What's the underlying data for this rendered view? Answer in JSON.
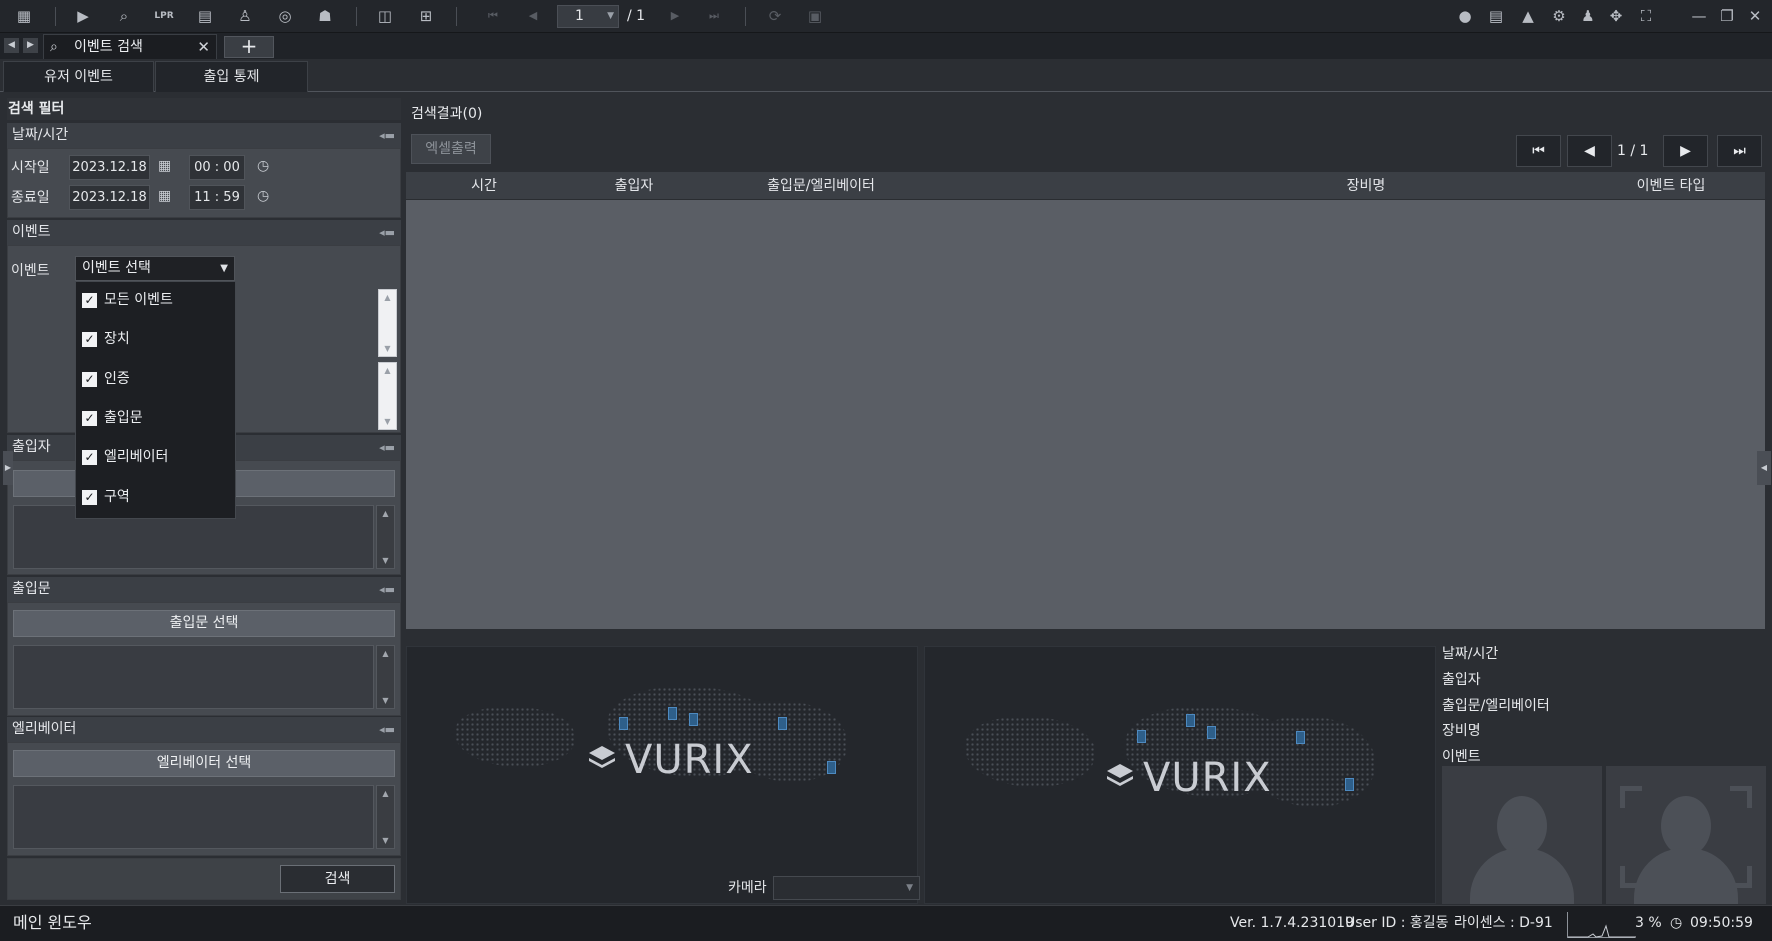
{
  "toolbar": {
    "icons": [
      "grid-icon",
      "play-icon",
      "playback-search-icon",
      "lpr-icon",
      "layout-icon",
      "person-search-icon",
      "bicycle-icon",
      "user-map-icon",
      "split-view-icon",
      "add-screen-icon",
      "first-page-icon",
      "prev-page-icon",
      "next-page-icon",
      "last-page-icon",
      "refresh-icon",
      "calendar-refresh-icon",
      "chat-icon",
      "notice-icon",
      "alarm-icon",
      "settings-icon",
      "user-icon",
      "move-icon",
      "fullscreen-icon",
      "minimize-icon",
      "restore-icon",
      "close-icon"
    ],
    "lpr_label": "LPR",
    "page_current": "1",
    "page_total": "/ 1"
  },
  "tabs": {
    "main_tab_label": "이벤트 검색",
    "add_label": "+"
  },
  "subtabs": [
    "유저 이벤트",
    "출입 통제"
  ],
  "filter": {
    "title": "검색 필터",
    "datetime": {
      "header": "날짜/시간",
      "start_label": "시작일",
      "start_date": "2023.12.18",
      "start_time": "00 : 00",
      "end_label": "종료일",
      "end_date": "2023.12.18",
      "end_time": "11 : 59"
    },
    "event": {
      "header": "이벤트",
      "label": "이벤트",
      "select_value": "이벤트 선택",
      "options": [
        "모든 이벤트",
        "장치",
        "인증",
        "출입문",
        "엘리베이터",
        "구역"
      ]
    },
    "person": {
      "header": "출입자"
    },
    "door": {
      "header": "출입문",
      "button": "출입문 선택"
    },
    "elevator": {
      "header": "엘리베이터",
      "button": "엘리베이터 선택"
    },
    "search_button": "검색"
  },
  "results": {
    "title": "검색결과(0)",
    "excel_button": "엑셀출력",
    "page_text": "1  /  1",
    "columns": [
      "시간",
      "출입자",
      "출입문/엘리베이터",
      "장비명",
      "이벤트 타입"
    ]
  },
  "preview": {
    "logo_text": "VURIX",
    "camera_label": "카메라",
    "info_labels": [
      "날짜/시간",
      "출입자",
      "출입문/엘리베이터",
      "장비명",
      "이벤트"
    ]
  },
  "status": {
    "window_title": "메인 윈도우",
    "version": "Ver. 1.7.4.231019",
    "user": "User ID : 홍길동",
    "license": "라이센스 : D-91",
    "cpu": "3 %",
    "time": "09:50:59"
  },
  "colors": {
    "background": "#2b2e33",
    "toolbar": "#23262b",
    "result_area": "#5a5e65",
    "button": "#5b6068",
    "accent_marker": "#4e8ac0"
  }
}
